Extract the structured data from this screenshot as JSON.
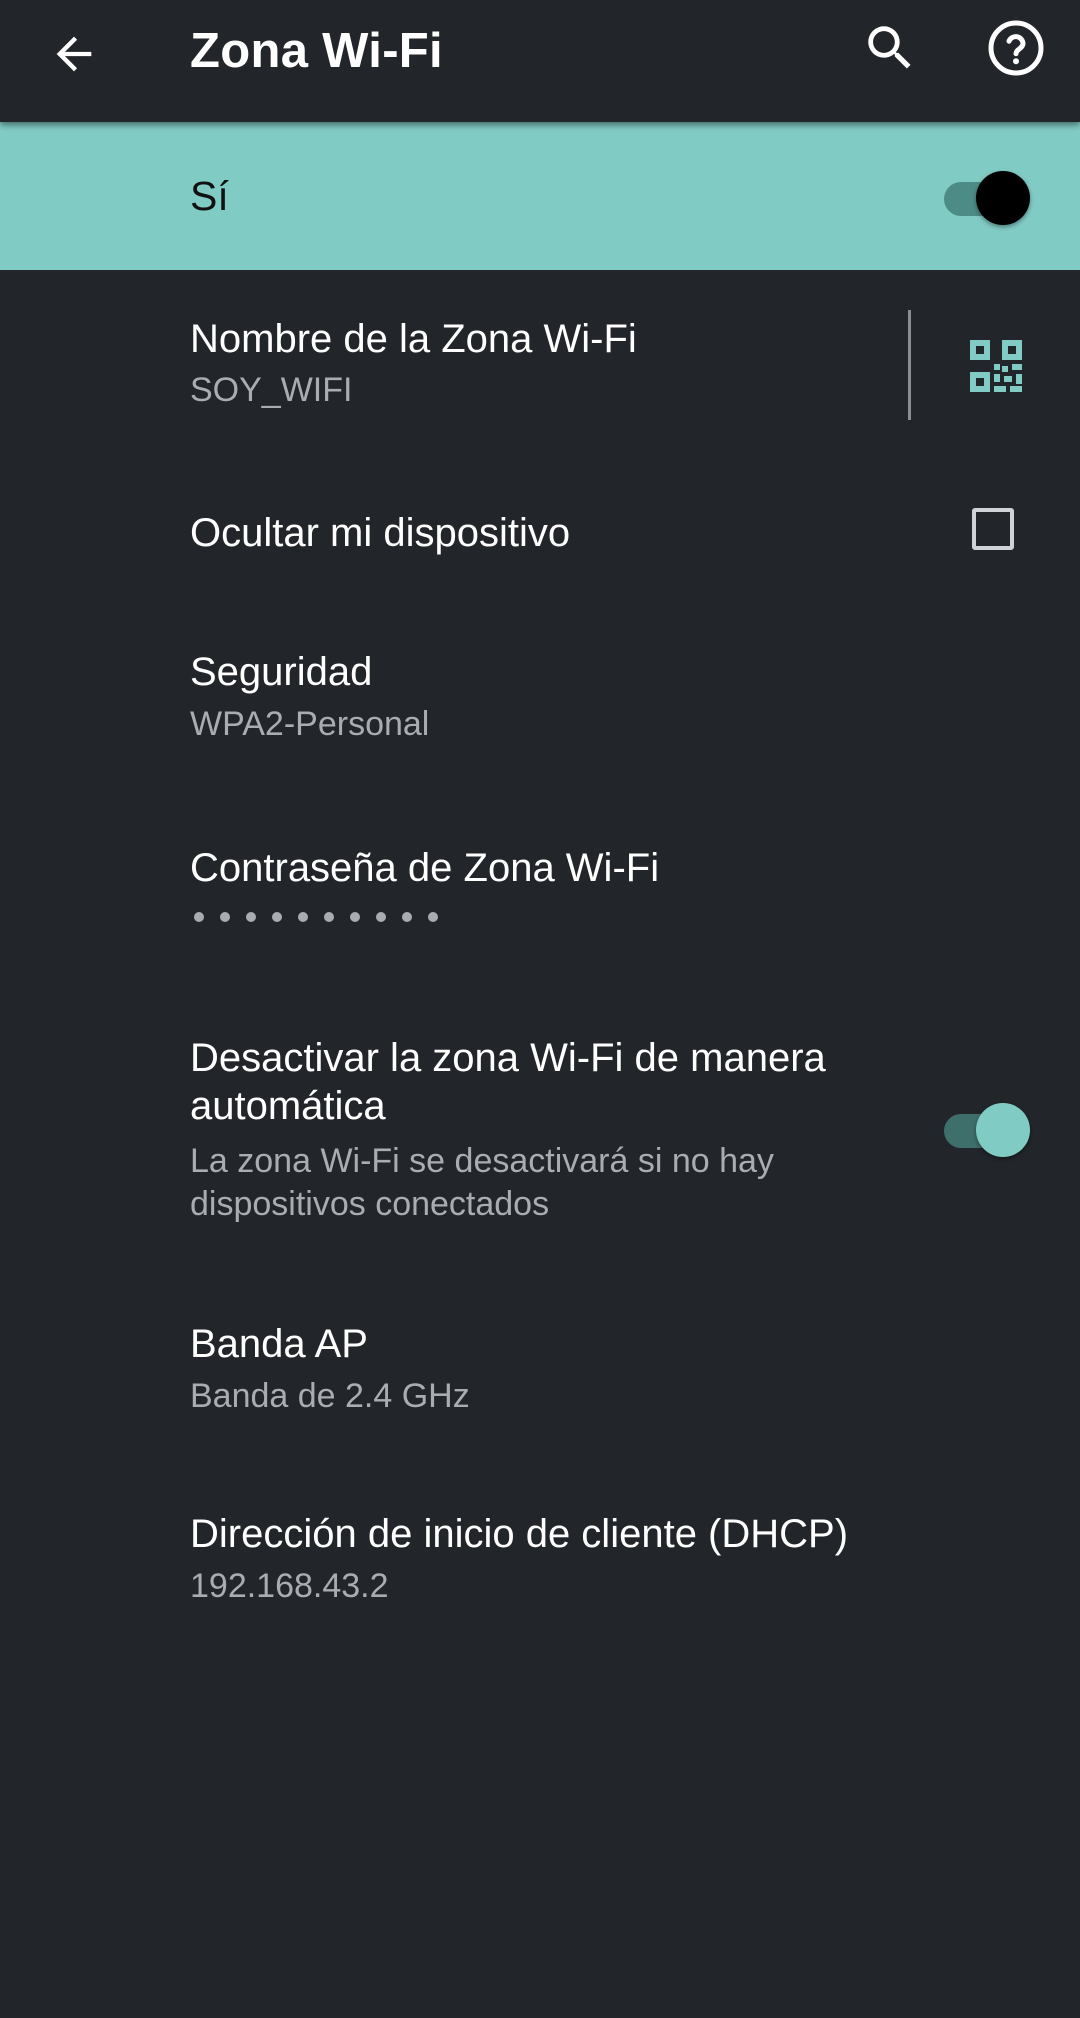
{
  "toolbar": {
    "title": "Zona Wi-Fi",
    "back_icon": "arrow-back-icon",
    "search_icon": "search-icon",
    "help_icon": "help-circle-icon"
  },
  "master_switch": {
    "label": "Sí",
    "checked": true
  },
  "preferences": {
    "ssid": {
      "title": "Nombre de la Zona Wi-Fi",
      "summary": "SOY_WIFI",
      "action_icon": "qr-code-icon"
    },
    "hide_device": {
      "title": "Ocultar mi dispositivo",
      "checked": false
    },
    "security": {
      "title": "Seguridad",
      "summary": "WPA2-Personal"
    },
    "password": {
      "title": "Contraseña de Zona Wi-Fi",
      "masked_length": 10
    },
    "auto_off": {
      "title_line1": "Desactivar la zona Wi-Fi de manera",
      "title_line2": "automática",
      "summary_line1": "La zona Wi-Fi se desactivará si no hay",
      "summary_line2": "dispositivos conectados",
      "checked": true
    },
    "ap_band": {
      "title": "Banda AP",
      "summary": "Banda de 2.4 GHz"
    },
    "dhcp": {
      "title": "Dirección de inicio de cliente (DHCP)",
      "summary": "192.168.43.2"
    }
  },
  "colors": {
    "background": "#22262a",
    "accent": "#80cbc4",
    "text_primary": "#ffffff",
    "text_secondary": "#a9adb1"
  }
}
